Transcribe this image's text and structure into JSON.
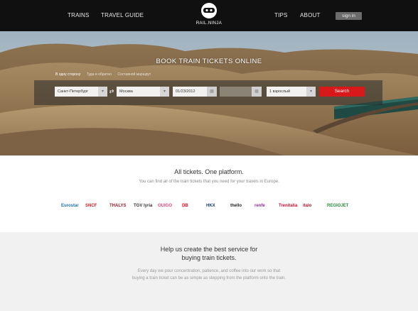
{
  "nav": {
    "left": [
      "TRAINS",
      "TRAVEL GUIDE"
    ],
    "right": [
      "TIPS",
      "ABOUT"
    ],
    "signin": "sign in"
  },
  "logo": {
    "text": "RAIL.NINJA",
    "icon": "ninja-mascot-icon"
  },
  "hero": {
    "title": "BOOK TRAIN TICKETS ONLINE",
    "trip_types": [
      "В одну сторону",
      "Туда и обратно",
      "Составной маршрут"
    ],
    "from_value": "Санкт-Петербург",
    "to_value": "Москва",
    "date_value": "01/23/2012",
    "passengers_value": "1 взрослый",
    "search_label": "Search",
    "swap_icon": "swap-arrows-icon",
    "calendar_icon": "calendar-icon",
    "dropdown_icon": "chevron-down-icon"
  },
  "platform": {
    "title": "All tickets. One platform.",
    "subtitle": "You can find all of the train tickets that you need for your travels in Europe.",
    "brands": [
      {
        "name": "Eurostar",
        "color": "#1d6fa5"
      },
      {
        "name": "SNCF",
        "color": "#d61f26"
      },
      {
        "name": "THALYS",
        "color": "#9b1b30"
      },
      {
        "name": "TGV lyria",
        "color": "#333333"
      },
      {
        "name": "OUIGO",
        "color": "#e0457b"
      },
      {
        "name": "DB",
        "color": "#ec0016"
      },
      {
        "name": "HKX",
        "color": "#1a3e7a"
      },
      {
        "name": "thello",
        "color": "#222222"
      },
      {
        "name": "renfe",
        "color": "#8a2b8f"
      },
      {
        "name": "Trenitalia",
        "color": "#c8102e"
      },
      {
        "name": "italo",
        "color": "#a6192e"
      },
      {
        "name": "REGIOJET",
        "color": "#2a8c3c"
      }
    ]
  },
  "help": {
    "title_line1": "Help us create the best service for",
    "title_line2": "buying train tickets.",
    "text_line1": "Every day we pour concentration, patience, and coffee into our work so that",
    "text_line2": "buying a train ticket can be as simple as stepping from the platform onto the train."
  },
  "colors": {
    "accent": "#d9181a",
    "topbar": "#101010",
    "help_bg": "#f1f1f1"
  }
}
